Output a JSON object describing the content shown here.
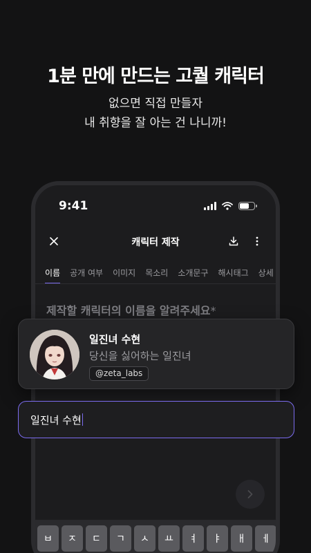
{
  "promo": {
    "headline": "1분 만에 만드는 고퀄 캐릭터",
    "sub1": "없으면 직접 만들자",
    "sub2": "내 취향을 잘 아는 건 나니까!"
  },
  "status_bar": {
    "time": "9:41"
  },
  "appbar": {
    "title": "캐릭터 제작"
  },
  "tabs": [
    "이름",
    "공개 여부",
    "이미지",
    "목소리",
    "소개문구",
    "해시태그",
    "상세"
  ],
  "question": {
    "text": "제작할 캐릭터의 이름을 알려주세요",
    "required_mark": "*"
  },
  "character_card": {
    "name": "일진녀 수현",
    "description": "당신을 싫어하는 일진녀",
    "handle": "@zeta_labs"
  },
  "name_input": {
    "value": "일진녀 수현"
  },
  "keyboard": {
    "keys": [
      "ㅂ",
      "ㅈ",
      "ㄷ",
      "ㄱ",
      "ㅅ",
      "ㅛ",
      "ㅕ",
      "ㅑ",
      "ㅐ",
      "ㅔ"
    ]
  },
  "colors": {
    "accent": "#7c6cf0",
    "background": "#131314"
  }
}
